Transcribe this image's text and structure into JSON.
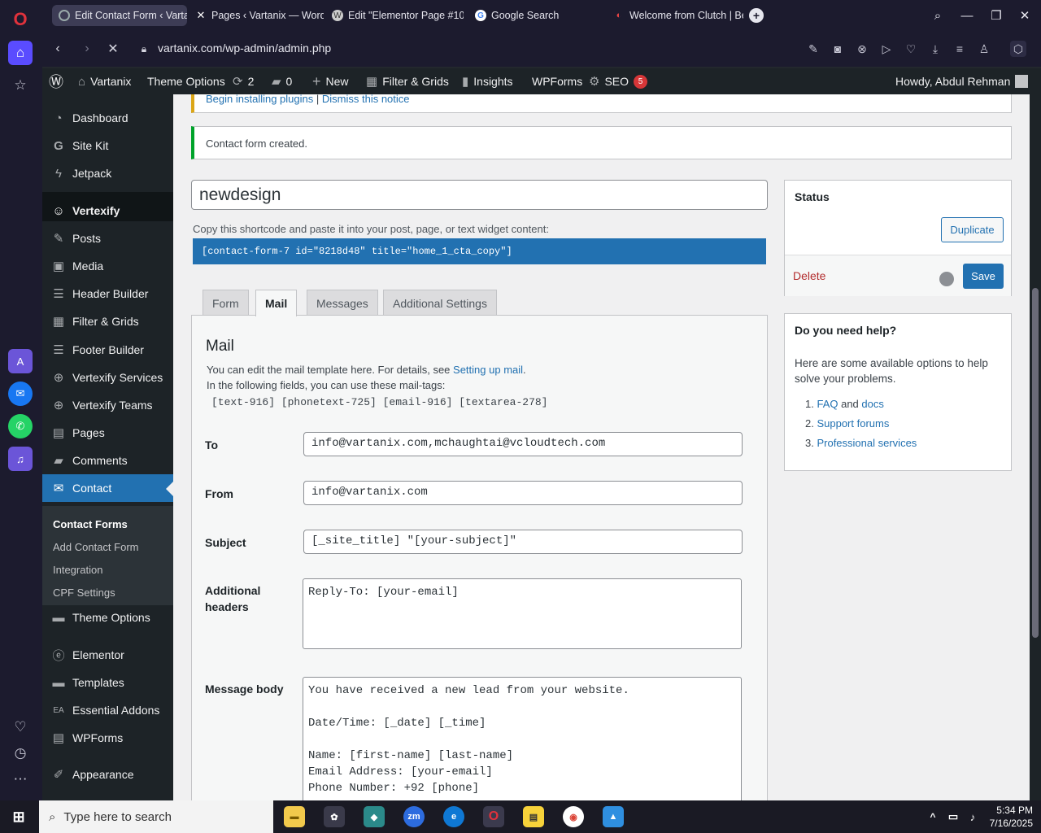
{
  "browser": {
    "tabs": [
      {
        "title": "Edit Contact Form ‹ Vartan",
        "active": true
      },
      {
        "title": "Pages ‹ Vartanix — WordP"
      },
      {
        "title": "Edit \"Elementor Page #100"
      },
      {
        "title": "Google Search"
      },
      {
        "title": "Welcome from Clutch | Be"
      }
    ],
    "url": "vartanix.com/wp-admin/admin.php"
  },
  "adminbar": {
    "site": "Vartanix",
    "theme_options": "Theme Options",
    "updates": "2",
    "comments": "0",
    "new": "New",
    "filter_grids": "Filter & Grids",
    "insights": "Insights",
    "wpforms": "WPForms",
    "seo": "SEO",
    "seo_badge": "5",
    "howdy": "Howdy, Abdul Rehman"
  },
  "menu": {
    "items": [
      {
        "label": "Dashboard",
        "icon": "dashboard-icon"
      },
      {
        "label": "Site Kit",
        "icon": "google-g-icon"
      },
      {
        "label": "Jetpack",
        "icon": "jetpack-icon"
      },
      {
        "label": "Vertexify",
        "icon": "smile-icon"
      },
      {
        "label": "Posts",
        "icon": "pin-icon"
      },
      {
        "label": "Media",
        "icon": "media-icon"
      },
      {
        "label": "Header Builder",
        "icon": "header-icon"
      },
      {
        "label": "Filter & Grids",
        "icon": "grid-icon"
      },
      {
        "label": "Footer Builder",
        "icon": "footer-icon"
      },
      {
        "label": "Vertexify Services",
        "icon": "plus-circle-icon"
      },
      {
        "label": "Vertexify Teams",
        "icon": "plus-circle-icon"
      },
      {
        "label": "Pages",
        "icon": "page-icon"
      },
      {
        "label": "Comments",
        "icon": "comment-icon"
      },
      {
        "label": "Contact",
        "icon": "mail-icon"
      },
      {
        "label": "Theme Options",
        "icon": "folder-icon"
      },
      {
        "label": "Elementor",
        "icon": "elementor-icon"
      },
      {
        "label": "Templates",
        "icon": "folder-icon"
      },
      {
        "label": "Essential Addons",
        "icon": "ea-icon"
      },
      {
        "label": "WPForms",
        "icon": "form-icon"
      },
      {
        "label": "Appearance",
        "icon": "brush-icon"
      }
    ],
    "submenu": [
      "Contact Forms",
      "Add Contact Form",
      "Integration",
      "CPF Settings"
    ]
  },
  "notices": {
    "plugins_begin": "Begin installing plugins",
    "plugins_sep": " | ",
    "plugins_dismiss": "Dismiss this notice",
    "created": "Contact form created."
  },
  "form": {
    "title": "newdesign",
    "shortcode_label": "Copy this shortcode and paste it into your post, page, or text widget content:",
    "shortcode": "[contact-form-7 id=\"8218d48\" title=\"home_1_cta_copy\"]",
    "tabs": [
      "Form",
      "Mail",
      "Messages",
      "Additional Settings"
    ]
  },
  "mail": {
    "heading": "Mail",
    "intro": "You can edit the mail template here. For details, see ",
    "intro_link": "Setting up mail",
    "intro_end": ".",
    "tags_intro": "In the following fields, you can use these mail-tags:",
    "tags": "[text-916] [phonetext-725] [email-916] [textarea-278]",
    "to_label": "To",
    "to": "info@vartanix.com,mchaughtai@vcloudtech.com",
    "from_label": "From",
    "from": "info@vartanix.com",
    "subject_label": "Subject",
    "subject": "[_site_title] \"[your-subject]\"",
    "headers_label_1": "Additional",
    "headers_label_2": "headers",
    "headers": "Reply-To: [your-email]",
    "body_label": "Message body",
    "body": "You have received a new lead from your website.\n\nDate/Time: [_date] [_time]\n\nName: [first-name] [last-name]\nEmail Address: [your-email]\nPhone Number: +92 [phone]"
  },
  "status_box": {
    "title": "Status",
    "duplicate": "Duplicate",
    "delete": "Delete",
    "save": "Save"
  },
  "help_box": {
    "title": "Do you need help?",
    "text": "Here are some available options to help solve your problems.",
    "items": [
      {
        "num": "1.",
        "link1": "FAQ",
        "mid": " and ",
        "link2": "docs"
      },
      {
        "num": "2.",
        "link1": "Support forums"
      },
      {
        "num": "3.",
        "link1": "Professional services"
      }
    ]
  },
  "taskbar": {
    "search_placeholder": "Type here to search",
    "time": "5:34 PM",
    "date": "7/16/2025"
  },
  "colors": {
    "wp_blue": "#2271b1",
    "admin_dark": "#1d2327",
    "delete_red": "#b32d2e"
  }
}
